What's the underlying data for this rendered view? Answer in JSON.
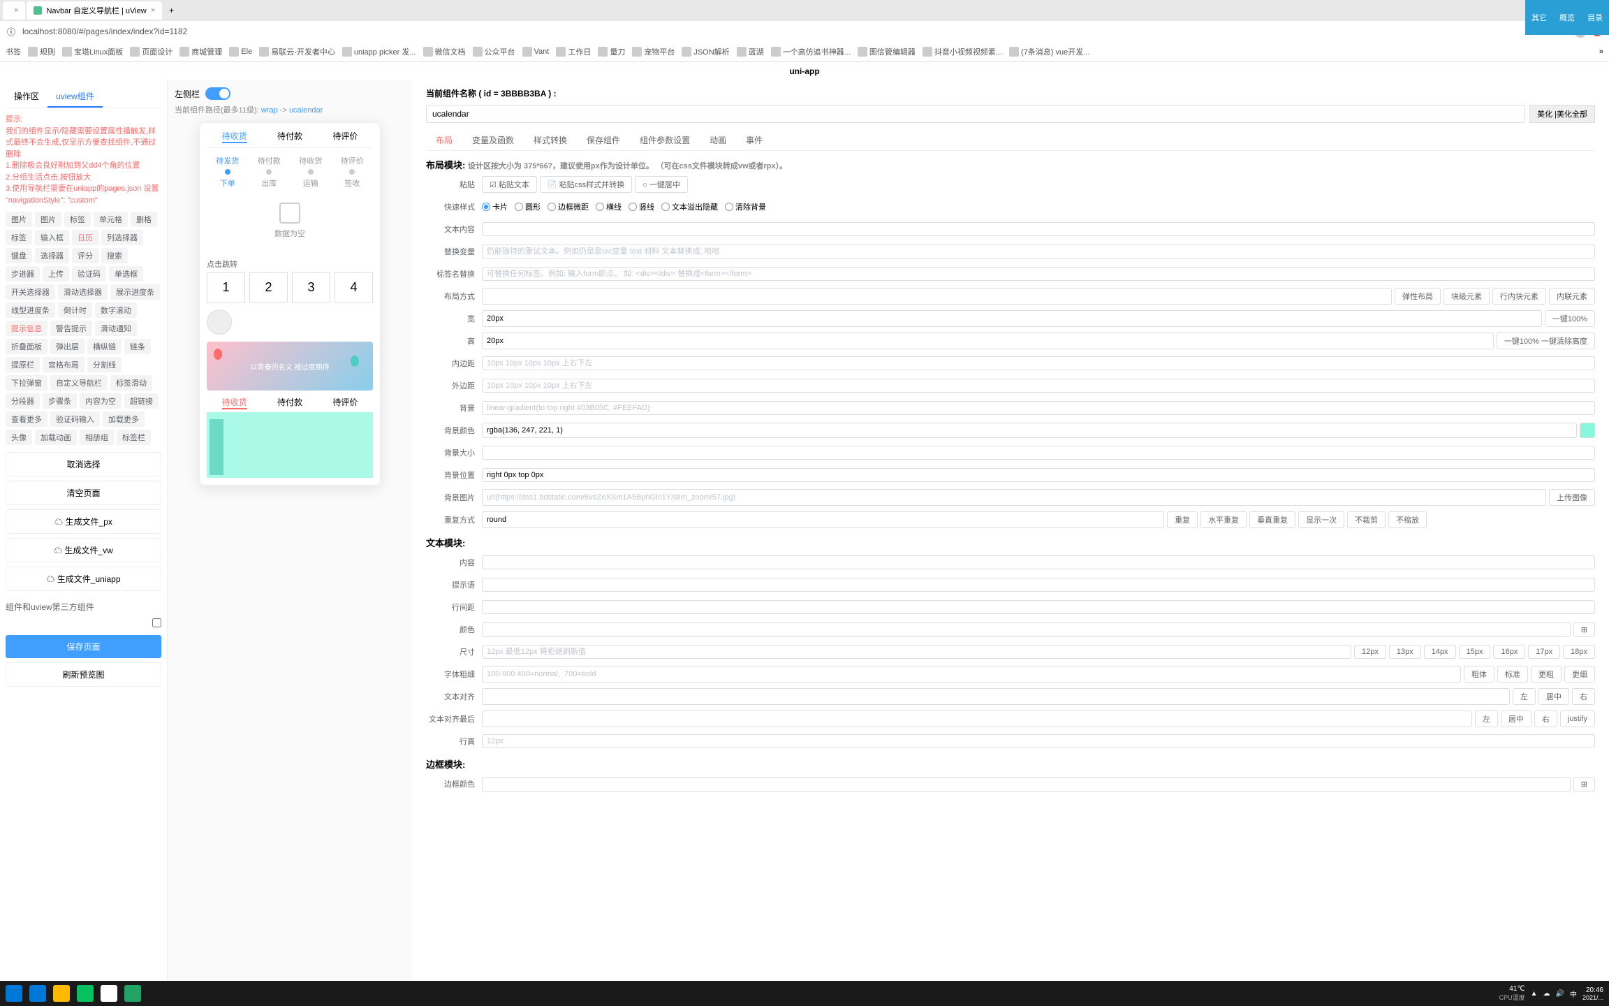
{
  "browser": {
    "tabs": [
      {
        "title": "",
        "close": "×"
      },
      {
        "title": "Navbar 自定义导航栏 | uView",
        "close": "×"
      }
    ],
    "new_tab": "+",
    "window_min": "—",
    "window_max": "☐",
    "window_close": "✕",
    "url": "localhost:8080/#/pages/index/index?id=1182",
    "star": "☆"
  },
  "right_strip": {
    "a": "其它",
    "b": "概览",
    "c": "目录"
  },
  "bookmarks": [
    "书签",
    "规则",
    "宝塔Linux面板",
    "页面设计",
    "商城管理",
    "Ele",
    "易联云-开发者中心",
    "uniapp picker 发...",
    "微信文档",
    "公众平台",
    "Vant",
    "工作日",
    "量刀",
    "宠物平台",
    "JSON解析",
    "蓝湖",
    "一个高仿追书神器...",
    "图信管编辑器",
    "抖音小视频视频素...",
    "(7条消息) vue开发..."
  ],
  "app_header": "uni-app",
  "left": {
    "tabs": {
      "a": "操作区",
      "b": "uview组件"
    },
    "hint_title": "提示:",
    "hint_1": "我们的组件显示/隐藏需要设置属性播触发,样式最终不会生成,仅显示方便查找组件,不通过删除",
    "hint_2": "1.删除吸会良好附加到父dd4个角的位置",
    "hint_3": "2.分组生活点击,按钮放大",
    "hint_4": "3.使用导航栏需要在uniapp的pages.json 设置 \"navigationStyle\": \"custom\"",
    "tags_row1": [
      "图片",
      "图片",
      "标签",
      "单元格",
      "删格",
      "标签"
    ],
    "tags_row2": [
      "输入框",
      "日历",
      "列选择器",
      "键盘",
      "选择器"
    ],
    "tags_row3": [
      "评分",
      "搜索",
      "步进器",
      "上传",
      "验证码",
      "单选框"
    ],
    "tags_row4": [
      "开关选择器",
      "滑动选择器",
      "展示进度条",
      "线型进度条"
    ],
    "tags_row5": [
      "倒计时",
      "数字滚动",
      "提示信息",
      "警告提示"
    ],
    "tags_row6": [
      "滑动通知",
      "折叠面板",
      "弹出层",
      "横纵链",
      "链条"
    ],
    "tags_row7": [
      "提原栏",
      "宫格布局",
      "分割线",
      "下拉弹窗"
    ],
    "tags_row8": [
      "自定义导航栏",
      "标签滑动",
      "分段器",
      "步骤条"
    ],
    "tags_row9": [
      "内容为空",
      "超链接",
      "查看更多",
      "验证码输入"
    ],
    "tags_row10": [
      "加载更多",
      "头像",
      "加载动画",
      "相册组",
      "标签栏"
    ],
    "btn_cancel": "取消选择",
    "btn_clear": "清空页面",
    "btn_gen_px": "☁ 生成文件_px",
    "btn_gen_vw": "☁ 生成文件_vw",
    "btn_gen_uniapp": "☁ 生成文件_uniapp",
    "third_party": "组件和uview第三方组件",
    "btn_save": "保存页面",
    "btn_refresh": "刷新预览图"
  },
  "center": {
    "toggle_label": "左侧栏",
    "breadcrumb_pre": "当前组件路径(最多11级):",
    "breadcrumb_1": "wrap",
    "breadcrumb_sep": "->",
    "breadcrumb_2": "ucalendar",
    "phone": {
      "tabs1": [
        "待收货",
        "待付款",
        "待评价"
      ],
      "steps": [
        {
          "t1": "待发货",
          "t2": "下单"
        },
        {
          "t1": "待付款",
          "t2": "出库"
        },
        {
          "t1": "待收货",
          "t2": "运输"
        },
        {
          "t1": "待评价",
          "t2": "签收"
        }
      ],
      "empty": "数据为空",
      "sec_label": "点击跳转",
      "nums": [
        "1",
        "2",
        "3",
        "4"
      ],
      "banner_text": "以青春的名义 被过度期待",
      "tabs2": [
        "待收货",
        "待付款",
        "待评价"
      ]
    }
  },
  "right": {
    "title_pre": "当前组件名称 ( id =",
    "title_id": "3BBBB3BA",
    "title_suf": ") :",
    "name_value": "ucalendar",
    "beautify": "美化 |美化全部",
    "tabs": [
      "布局",
      "变量及函数",
      "样式转换",
      "保存组件",
      "组件参数设置",
      "动画",
      "事件"
    ],
    "layout_module": "布局模块:",
    "layout_desc_1": "设计区按大小为 375*667，建议使用px作为设计单位。",
    "layout_desc_2": "（可在css文件模块转成vw或者rpx）。",
    "paste_label": "粘贴",
    "paste_opts": [
      "☑ 粘贴文本",
      "📄 粘贴css样式并转换",
      "○ 一键居中"
    ],
    "quick_label": "快速样式",
    "quick_opts": [
      {
        "t": "卡片",
        "on": true
      },
      {
        "t": "圆形",
        "on": false
      },
      {
        "t": "边框微距",
        "on": false
      },
      {
        "t": "横线",
        "on": false
      },
      {
        "t": "竖线",
        "on": false
      },
      {
        "t": "文本溢出隐藏",
        "on": false
      },
      {
        "t": "清除背景",
        "on": false
      }
    ],
    "rows": {
      "text_content": "文本内容",
      "replace_var": "替换变量",
      "replace_var_ph": "仍能独特的重试文本。例如仍是是src变量 text 材料 文本替换成: 哈哈",
      "tag_replace": "标签名替换",
      "tag_replace_ph": "可替换任何标签。例如: 输入form即点。 如: <div></div> 替换成<form></form>",
      "layout_mode": "布局方式",
      "layout_opts": [
        "弹性布局",
        "块级元素",
        "行内块元素",
        "内联元素"
      ],
      "width": "宽",
      "width_val": "20px",
      "width_btn": "一键100%",
      "height": "高",
      "height_val": "20px",
      "height_btn": "一键100% 一键清除高度",
      "padding": "内边距",
      "padding_ph": "10px 10px 10px 10px 上右下左",
      "margin": "外边距",
      "margin_ph": "10px 10px 10px 10px 上右下左",
      "bg": "背景",
      "bg_ph": "linear-gradient(to top right #03B05C, #FEEFAD)",
      "bg_color": "背景颜色",
      "bg_color_val": "rgba(136, 247, 221, 1)",
      "bg_size": "背景大小",
      "bg_pos": "背景位置",
      "bg_pos_val": "right 0px top 0px",
      "bg_img": "背景图片",
      "bg_img_ph": "url(https://dss1.bdstatic.com/6voZeXSm1A5BphGln1Y/slim_zoom/57.jpg)",
      "bg_img_btn": "上传图像",
      "repeat": "重复方式",
      "repeat_val": "round",
      "repeat_opts": [
        "重复",
        "水平重复",
        "垂直重复",
        "显示一次",
        "不裁剪",
        "不缩放"
      ]
    },
    "text_module": "文本模块:",
    "text_rows": {
      "content": "内容",
      "hint": "提示语",
      "line_height": "行间距",
      "color": "颜色",
      "size": "尺寸",
      "size_ph": "12px 最低12px 将拒绝刷新值",
      "size_opts": [
        "12px",
        "13px",
        "14px",
        "15px",
        "16px",
        "17px",
        "18px"
      ],
      "weight": "字体粗细",
      "weight_ph": "100-900 400=normal,  700=bold",
      "weight_opts": [
        "粗体",
        "标准",
        "更粗",
        "更细"
      ],
      "align": "文本对齐",
      "align_opts": [
        "左",
        "居中",
        "右"
      ],
      "align_last": "文本对齐最后",
      "align_last_opts": [
        "左",
        "居中",
        "右",
        "justify"
      ],
      "line_h2": "行高",
      "line_h2_ph": "12px"
    },
    "border_module": "边框模块:",
    "border_color": "边框颜色"
  },
  "taskbar": {
    "temp": "41℃",
    "temp_label": "CPU温度",
    "time": "20:46",
    "date": "2021/..."
  }
}
